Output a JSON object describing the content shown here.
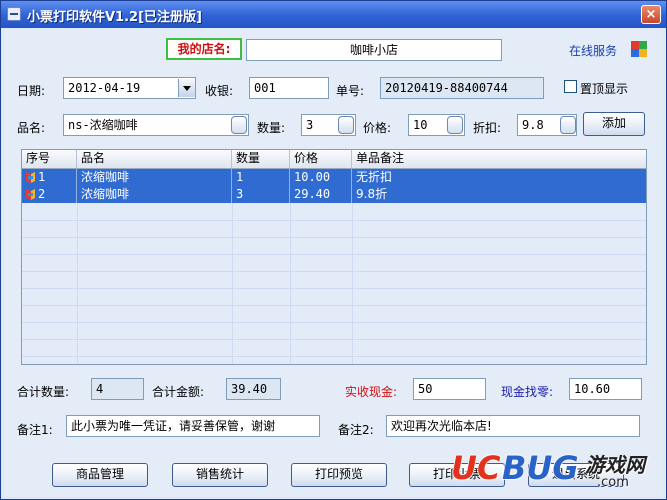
{
  "window": {
    "title": "小票打印软件V1.2[已注册版]",
    "close_label": "×"
  },
  "shop": {
    "label": "我的店名:",
    "name": "咖啡小店",
    "online_service": "在线服务"
  },
  "header": {
    "date_label": "日期:",
    "date_value": "2012-04-19",
    "cashier_label": "收银:",
    "cashier_value": "001",
    "order_label": "单号:",
    "order_value": "20120419-88400744",
    "ontop_label": "置顶显示"
  },
  "item_entry": {
    "name_label": "品名:",
    "name_value": "ns-浓缩咖啡",
    "qty_label": "数量:",
    "qty_value": "3",
    "price_label": "价格:",
    "price_value": "10",
    "discount_label": "折扣:",
    "discount_value": "9.8",
    "add_label": "添加"
  },
  "table": {
    "columns": [
      "序号",
      "品名",
      "数量",
      "价格",
      "单品备注"
    ],
    "rows": [
      {
        "index": "1",
        "name": "浓缩咖啡",
        "qty": "1",
        "price": "10.00",
        "note": "无折扣"
      },
      {
        "index": "2",
        "name": "浓缩咖啡",
        "qty": "3",
        "price": "29.40",
        "note": "9.8折"
      }
    ]
  },
  "totals": {
    "count_label": "合计数量:",
    "count_value": "4",
    "amount_label": "合计金额:",
    "amount_value": "39.40",
    "cash_label": "实收现金:",
    "cash_value": "50",
    "change_label": "现金找零:",
    "change_value": "10.60"
  },
  "notes": {
    "note1_label": "备注1:",
    "note1_value": "此小票为唯一凭证，请妥善保管，谢谢",
    "note2_label": "备注2:",
    "note2_value": "欢迎再次光临本店!"
  },
  "buttons": {
    "products": "商品管理",
    "sales": "销售统计",
    "preview": "打印预览",
    "print": "打印小票",
    "exit": "退出系统"
  },
  "watermark": {
    "brand": "UCBUG",
    "suffix": "游戏网",
    "domain": ".com"
  },
  "colors": {
    "titlebar": "#2f62d4",
    "selection": "#2f6bd0",
    "red_label": "#d01010",
    "blue_label": "#1a1aa8"
  }
}
